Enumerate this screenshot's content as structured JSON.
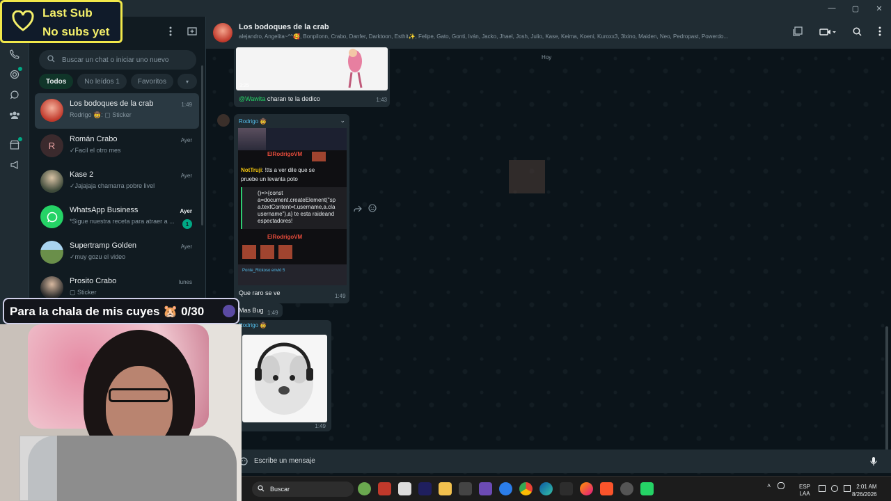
{
  "overlay": {
    "sub_line1": "Last Sub",
    "sub_line2": "No subs yet",
    "goal_text": "Para la chala de mis cuyes 🐹 0/30"
  },
  "search": {
    "placeholder": "Buscar un chat o iniciar uno nuevo"
  },
  "filters": [
    "Todos",
    "No leídos 1",
    "Favoritos"
  ],
  "chats": [
    {
      "name": "Los bodoques de la crab",
      "preview": "Rodrigo 🤠: ▢ Sticker",
      "time": "1:49",
      "selected": true
    },
    {
      "name": "Román Crabo",
      "preview": "✓Facil el otro mes",
      "time": "Ayer",
      "avatar_letter": "R"
    },
    {
      "name": "Kase 2",
      "preview": "✓Jajajaja chamarra pobre livel",
      "time": "Ayer"
    },
    {
      "name": "WhatsApp Business",
      "preview": "*Sigue nuestra receta para atraer a ...",
      "time": "Ayer",
      "badge": "1"
    },
    {
      "name": "Supertramp Golden",
      "preview": "✓muy gozu el video",
      "time": "Ayer"
    },
    {
      "name": "Prosito Crabo",
      "preview": "▢ Sticker",
      "time": "lunes"
    }
  ],
  "conversation": {
    "title": "Los bodoques de la crab",
    "members": "alejandro, Angelita~^^🥰, Bonpilonn, Crabo, Danfer, Darktoon, Esthit✨, Felipe, Gato, Gonti, Iván, Jacko, Jhael, Josh, Julio, Kase, Keima, Koeni, Kuroxx3, 3lxino, Maiden, Neo, Pedropast, Powerdo...",
    "day": "Hoy",
    "video_duration": "3:25",
    "msg1_mention": "@Wawita",
    "msg1_text": " charan te la dedico",
    "msg1_time": "1:43",
    "msg2_sender": "Rodrigo 🤠",
    "stream_user1": "ElRodrigoVM",
    "stream_user2": "NotTruji",
    "stream_msg": ": !tts a ver dile que se",
    "stream_msg2": "pruebe un levanta poto",
    "stream_code": [
      "()=>{const",
      "a=document.createElement(\"sp",
      "a.textContent=t.username,a.cla",
      "username\"),a} te esta raideand",
      "espectadores!"
    ],
    "stream_footer": "Ponte_Rickoso envió 5",
    "msg2_text": "Que raro se ve",
    "msg2_time": "1:49",
    "msg3_text": "Mas Bug",
    "msg3_time": "1:49",
    "msg4_sender": "Rodrigo 🤠",
    "msg4_time": "1:49",
    "composer_placeholder": "Escribe un mensaje"
  },
  "taskbar": {
    "search_label": "Buscar",
    "lang_line1": "ESP",
    "lang_line2": "LAA",
    "time": "2:01 AM",
    "date": "8/26/2026"
  },
  "colors": {
    "accent": "#00a884",
    "panel": "#202c33",
    "background": "#0b141a"
  }
}
